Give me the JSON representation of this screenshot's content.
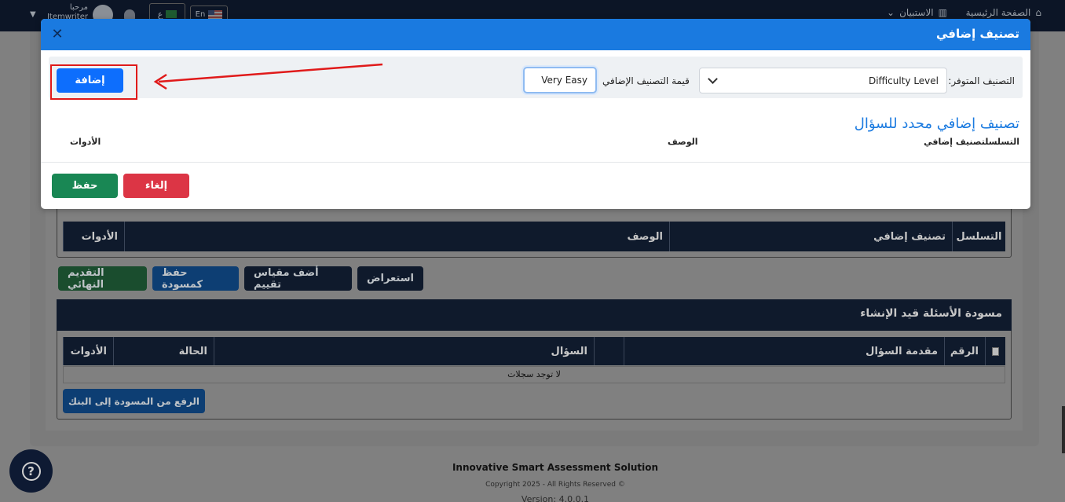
{
  "colors": {
    "primary_blue": "#1a7ae0",
    "add_button": "#0d6efd",
    "cancel_red": "#dc3545",
    "save_green": "#198754",
    "annotation_red": "#e01a1a",
    "navy": "#0f1a2c"
  },
  "topnav": {
    "home": "الصفحة الرئيسية",
    "questionnaire": "الاستبيان",
    "lang_en": "En",
    "lang_ar": "ع",
    "greeting": "مرحبا",
    "username": "Itemwriter"
  },
  "background": {
    "classification_table": {
      "headers": [
        "التسلسل",
        "تصنيف إضافي",
        "الوصف",
        "الأدوات"
      ]
    },
    "actions": {
      "final_submit": "التقديم النهائي",
      "save_draft": "حفظ كمسودة",
      "add_rubric": "أضف مقياس تقييم",
      "preview": "استعراض"
    },
    "drafts": {
      "title": "مسودة الأسئلة قيد الإنشاء",
      "headers": {
        "number": "الرقم",
        "intro": "مقدمة السؤال",
        "question": "السؤال",
        "status": "الحالة",
        "tools": "الأدوات"
      },
      "empty": "لا توجد سجلات",
      "upload": "الرفع من المسودة إلى البنك"
    },
    "footer": {
      "title": "Innovative Smart Assessment Solution",
      "copyright": "Copyright 2025 - All Rights Reserved ©",
      "version": "Version: 4.0.0.1"
    }
  },
  "modal": {
    "title": "تصنيف إضافي",
    "available_label": "التصنيف المتوفر:",
    "available_value": "Difficulty Level",
    "value_label": "قيمة التصنيف الإضافي",
    "value_input": "Very Easy",
    "add_button": "إضافة",
    "section_title": "تصنيف إضافي محدد للسؤال",
    "list_headers": {
      "seq": "التسلسلتصنيف إضافي",
      "description": "الوصف",
      "tools": "الأدوات"
    },
    "cancel_button": "إلغاء",
    "save_button": "حفظ"
  }
}
